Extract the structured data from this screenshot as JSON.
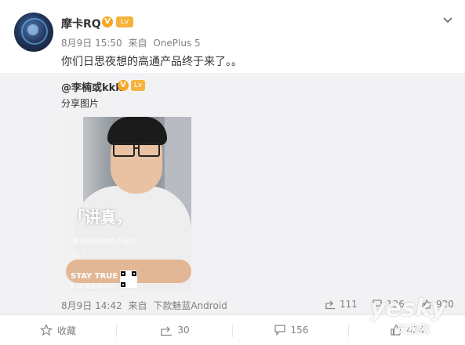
{
  "post": {
    "author": "摩卡RQ",
    "verified_badge": "V",
    "level_badge": "Lv",
    "date": "8月9日 15:50",
    "via_prefix": "来自",
    "device": "OnePlus 5",
    "content": "你们日思夜想的高通产品终于来了。。",
    "repost": {
      "author": "@李楠或kkk",
      "verified_badge": "V",
      "level_badge": "Lv",
      "text": "分享图片",
      "photo": {
        "slogan": "「讲真，",
        "sub_line_1": "谁年轻的时候没有帅",
        "sub_line_2": "过。」",
        "stay_true": "STAY TRUE",
        "footer": "8.23   魅蓝 Note6"
      },
      "date": "8月9日 14:42",
      "via_prefix": "来自",
      "device": "下款魅蓝Android",
      "stats": {
        "reposts": "111",
        "comments": "136",
        "likes": "920"
      }
    },
    "actions": {
      "favorite": "收藏",
      "repost": "30",
      "comment": "156",
      "like": "424"
    }
  },
  "watermark": {
    "logo": "yesky",
    "sub": "天极网"
  },
  "colors": {
    "text_primary": "#333333",
    "text_secondary": "#808080",
    "repost_bg": "#f2f2f5",
    "badge_gold": "#f5a623"
  },
  "icons": [
    "avatar",
    "chevron-down-icon",
    "verified-icon",
    "level-icon",
    "repost-icon",
    "comment-icon",
    "like-icon",
    "favorite-icon"
  ]
}
